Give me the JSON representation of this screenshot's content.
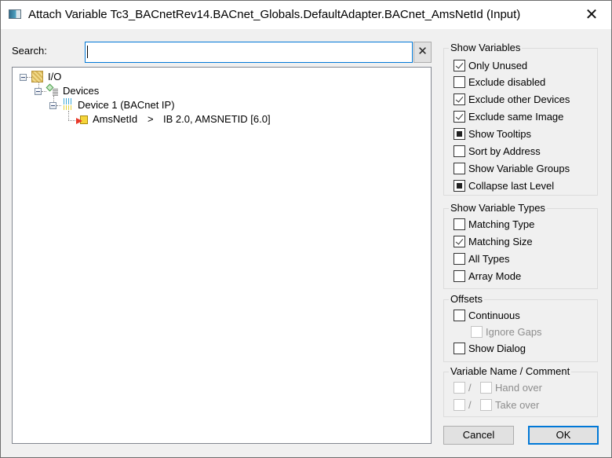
{
  "window": {
    "title": "Attach Variable Tc3_BACnetRev14.BACnet_Globals.DefaultAdapter.BACnet_AmsNetId (Input)",
    "close_glyph": "✕"
  },
  "search": {
    "label": "Search:",
    "value": "",
    "placeholder": "",
    "clear_glyph": "✕"
  },
  "tree": {
    "nodes": [
      {
        "label": "I/O",
        "icon": "io-icon",
        "expanded": true
      },
      {
        "label": "Devices",
        "icon": "devices-icon",
        "expanded": true
      },
      {
        "label": "Device 1 (BACnet IP)",
        "icon": "device-icon",
        "expanded": true
      },
      {
        "label": "AmsNetId",
        "icon": "input-variable-icon",
        "separator": ">",
        "detail": "IB 2.0, AMSNETID [6.0]"
      }
    ]
  },
  "show_variables": {
    "title": "Show Variables",
    "options": [
      {
        "label": "Only Unused",
        "state": "checked"
      },
      {
        "label": "Exclude disabled",
        "state": "unchecked"
      },
      {
        "label": "Exclude other Devices",
        "state": "checked"
      },
      {
        "label": "Exclude same Image",
        "state": "checked"
      },
      {
        "label": "Show Tooltips",
        "state": "indeterminate"
      },
      {
        "label": "Sort by Address",
        "state": "unchecked"
      },
      {
        "label": "Show Variable Groups",
        "state": "unchecked"
      },
      {
        "label": "Collapse last Level",
        "state": "indeterminate"
      }
    ]
  },
  "show_variable_types": {
    "title": "Show Variable Types",
    "options": [
      {
        "label": "Matching Type",
        "state": "unchecked"
      },
      {
        "label": "Matching Size",
        "state": "checked"
      },
      {
        "label": "All Types",
        "state": "unchecked"
      },
      {
        "label": "Array Mode",
        "state": "unchecked"
      }
    ]
  },
  "offsets": {
    "title": "Offsets",
    "continuous": {
      "label": "Continuous",
      "state": "unchecked"
    },
    "ignore_gaps": {
      "label": "Ignore Gaps",
      "state": "unchecked",
      "disabled": true
    },
    "show_dialog": {
      "label": "Show Dialog",
      "state": "unchecked"
    }
  },
  "variable_name_comment": {
    "title": "Variable Name / Comment",
    "separator": "/",
    "hand_over": {
      "label": "Hand over",
      "disabled": true
    },
    "take_over": {
      "label": "Take over",
      "disabled": true
    }
  },
  "buttons": {
    "cancel": "Cancel",
    "ok": "OK"
  }
}
